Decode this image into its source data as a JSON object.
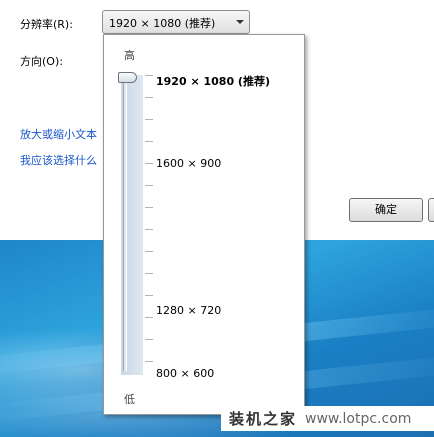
{
  "settings": {
    "resolution_label": "分辨率(R):",
    "resolution_value": "1920 × 1080 (推荐)",
    "orientation_label": "方向(O):",
    "link_text_size": "放大或缩小文本",
    "link_what_to_choose": "我应该选择什么"
  },
  "buttons": {
    "ok": "确定"
  },
  "dropdown": {
    "high_label": "高",
    "low_label": "低",
    "options": [
      "1920 × 1080 (推荐)",
      "1600 × 900",
      "1280 × 720",
      "800 × 600"
    ],
    "selected_index": 0
  },
  "watermark": {
    "site_name": "装机之家",
    "url": "www.lotpc.com"
  }
}
